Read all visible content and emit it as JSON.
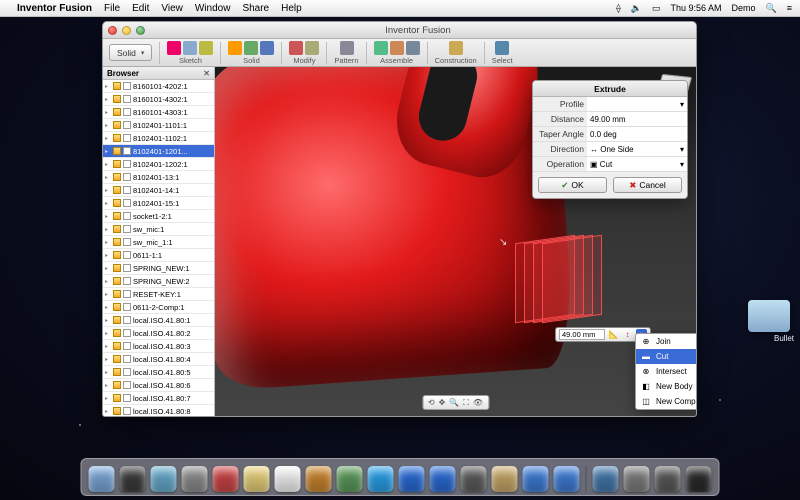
{
  "menubar": {
    "app": "Inventor Fusion",
    "items": [
      "File",
      "Edit",
      "View",
      "Window",
      "Share",
      "Help"
    ],
    "time": "Thu 9:56 AM",
    "user": "Demo"
  },
  "window": {
    "title": "Inventor Fusion"
  },
  "toolbar": {
    "solid_btn": "Solid",
    "groups": {
      "sketch": "Sketch",
      "solid": "Solid",
      "modify": "Modify",
      "pattern": "Pattern",
      "assemble": "Assemble",
      "construction": "Construction",
      "select": "Select"
    }
  },
  "browser": {
    "title": "Browser",
    "items": [
      "8160101-4202:1",
      "8160101-4302:1",
      "8160101-4303:1",
      "8102401-1101:1",
      "8102401-1102:1",
      "8102401-1201...",
      "8102401-1202:1",
      "8102401-13:1",
      "8102401-14:1",
      "8102401-15:1",
      "socket1-2:1",
      "sw_mic:1",
      "sw_mic_1:1",
      "0611-1:1",
      "SPRING_NEW:1",
      "SPRING_NEW:2",
      "RESET-KEY:1",
      "0611-2-Comp:1",
      "local.ISO.41.80:1",
      "local.ISO.41.80:2",
      "local.ISO.41.80:3",
      "local.ISO.41.80:4",
      "local.ISO.41.80:5",
      "local.ISO.41.80:6",
      "local.ISO.41.80:7",
      "local.ISO.41.80:8"
    ],
    "selected_index": 5
  },
  "extrude_value": "49.00 mm",
  "context_menu": {
    "items": [
      "Join",
      "Cut",
      "Intersect",
      "New Body",
      "New Component"
    ],
    "selected_index": 1
  },
  "extrude_panel": {
    "title": "Extrude",
    "rows": {
      "profile_label": "Profile",
      "profile_val": "",
      "distance_label": "Distance",
      "distance_val": "49.00 mm",
      "taper_label": "Taper Angle",
      "taper_val": "0.0 deg",
      "direction_label": "Direction",
      "direction_val": "One Side",
      "operation_label": "Operation",
      "operation_val": "Cut"
    },
    "ok": "OK",
    "cancel": "Cancel"
  },
  "desktop_folder": "Bullet",
  "dock_colors": [
    "#7aa6d8",
    "#3b3b3b",
    "#6ac",
    "#8c8c8c",
    "#c44",
    "#e8cf7a",
    "#f4f4f4",
    "#c9852d",
    "#5a9a5a",
    "#2aa0e8",
    "#2a6bd6",
    "#2a6bd6",
    "#5c5c5c",
    "#c7a768",
    "#3e7cd6",
    "#3e7cd6",
    "#47a",
    "#7d7d7d",
    "#5a5a5a",
    "#2a2a2a"
  ]
}
